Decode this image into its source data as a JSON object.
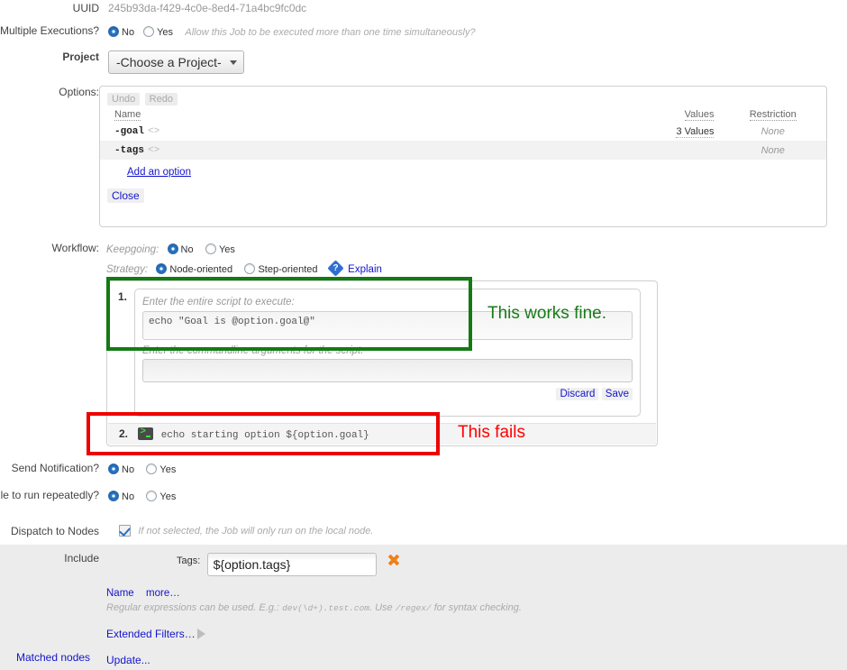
{
  "form": {
    "uuid_label": "UUID",
    "uuid_value": "245b93da-f429-4c0e-8ed4-71a4bc9fc0dc",
    "multiple_executions_label": "Multiple Executions?",
    "multiple_executions_no": "No",
    "multiple_executions_yes": "Yes",
    "multiple_executions_hint": "Allow this Job to be executed more than one time simultaneously?",
    "project_label": "Project",
    "project_value": "-Choose a Project-",
    "options_label": "Options:",
    "workflow_label": "Workflow:",
    "send_notification_label": "Send Notification?",
    "send_notification_no": "No",
    "send_notification_yes": "Yes",
    "schedule_label": "ule to run repeatedly?",
    "schedule_no": "No",
    "schedule_yes": "Yes",
    "dispatch_label": "Dispatch to Nodes",
    "dispatch_hint": "If not selected, the Job will only run on the local node.",
    "include_label": "Include",
    "matched_nodes_label": "Matched nodes"
  },
  "options": {
    "undo": "Undo",
    "redo": "Redo",
    "columns": [
      "Name",
      "Values",
      "Restriction"
    ],
    "rows": [
      {
        "name": "-goal",
        "glyph": "<>",
        "values": "3 Values",
        "restriction": "None"
      },
      {
        "name": "-tags",
        "glyph": "<>",
        "values": "",
        "restriction": "None"
      }
    ],
    "add_option": "Add an option",
    "close": "Close"
  },
  "workflow": {
    "keepgoing_label": "Keepgoing:",
    "keepgoing_no": "No",
    "keepgoing_yes": "Yes",
    "strategy_label": "Strategy:",
    "strategy_node": "Node-oriented",
    "strategy_step": "Step-oriented",
    "explain": "Explain",
    "step1": {
      "number": "1.",
      "script_label": "Enter the entire script to execute:",
      "script_value": "echo \"Goal is @option.goal@\"",
      "args_label": "Enter the commandline arguments for the script:",
      "args_value": "",
      "discard": "Discard",
      "save": "Save"
    },
    "step2": {
      "number": "2.",
      "command": "echo starting option ${option.goal}",
      "icon": "terminal-icon"
    }
  },
  "annotations": [
    {
      "text": "This works fine.",
      "color": "#1a7a1a"
    },
    {
      "text": "This fails",
      "color": "#ff0000"
    }
  ],
  "include": {
    "tags_label": "Tags:",
    "tags_value": "${option.tags}",
    "name_link": "Name",
    "more_link": "more…",
    "regex_hint_1": "Regular expressions can be used. E.g.: ",
    "regex_hint_mono_1": "dev(\\d+).test.com",
    "regex_hint_2": ". Use ",
    "regex_hint_mono_2": "/regex/",
    "regex_hint_3": " for syntax checking.",
    "extended_filters": "Extended Filters…",
    "update": "Update..."
  },
  "colors": {
    "link": "#1414cc",
    "annotation_green": "#1a7a1a",
    "annotation_red": "#ff0000",
    "radio_blue": "#2f7fd0"
  }
}
